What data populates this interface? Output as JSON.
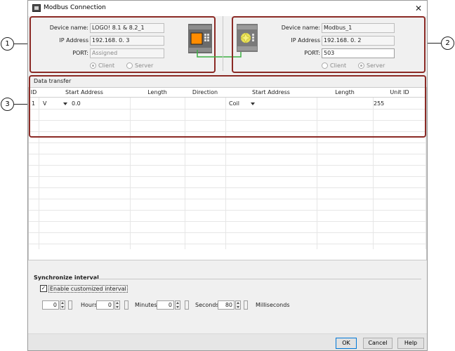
{
  "window": {
    "title": "Modbus Connection",
    "close_glyph": "✕"
  },
  "callouts": [
    "1",
    "2",
    "3"
  ],
  "left_device": {
    "labels": {
      "device_name": "Device name:",
      "ip_address": "IP Address",
      "port": "PORT:"
    },
    "device_name": "LOGO! 8.1 & 8.2_1",
    "ip_address": "192.168.  0.  3",
    "port": "Assigned",
    "client_label": "Client",
    "server_label": "Server",
    "selected_role": "client",
    "icon": "logo-plc-icon"
  },
  "right_device": {
    "labels": {
      "device_name": "Device name:",
      "ip_address": "IP Address",
      "port": "PORT:"
    },
    "device_name": "Modbus_1",
    "ip_address": "192.168.  0.  2",
    "port": "503",
    "client_label": "Client",
    "server_label": "Server",
    "selected_role": "server",
    "icon": "modbus-device-icon"
  },
  "data_transfer": {
    "group_label": "Data transfer",
    "columns": [
      "ID",
      "Start Address",
      "Length",
      "Direction",
      "Start Address",
      "Length",
      "Unit ID"
    ],
    "rows": [
      {
        "id": "1",
        "area": "V",
        "start_address": "0.0",
        "length": "",
        "direction": "",
        "target_type": "Coil",
        "target_start": "",
        "target_length": "",
        "unit_id": "255"
      }
    ]
  },
  "sync": {
    "title": "Synchronize interval",
    "enable_label": "Enable customized interval",
    "enabled": true,
    "check_glyph": "✓",
    "hours": "0",
    "hours_label": "Hours",
    "minutes": "0",
    "minutes_label": "Minutes",
    "seconds": "0",
    "seconds_label": "Seconds",
    "milliseconds": "80",
    "milliseconds_label": "Milliseconds"
  },
  "buttons": {
    "ok": "OK",
    "cancel": "Cancel",
    "help": "Help"
  },
  "colors": {
    "annotation_red": "#8b2a25",
    "link_green": "#3cb043",
    "accent": "#0078d7"
  }
}
